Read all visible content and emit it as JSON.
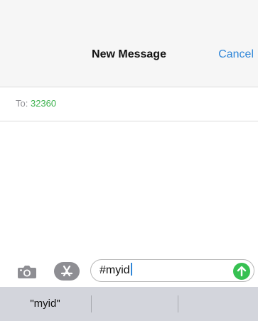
{
  "navbar": {
    "title": "New Message",
    "cancel_label": "Cancel"
  },
  "recipient": {
    "label": "To:",
    "value": "32360"
  },
  "compose": {
    "camera_icon": "camera-icon",
    "appstore_icon": "app-store-icon",
    "message_text": "#myid",
    "send_icon": "send-arrow-up-icon"
  },
  "suggestions": [
    {
      "label": "\"myid\""
    },
    {
      "label": ""
    },
    {
      "label": ""
    }
  ],
  "colors": {
    "accent_blue": "#2f86d8",
    "recipient_green": "#3eb24f",
    "send_green": "#37c152",
    "navbar_bg": "#f6f6f6",
    "suggestion_bar_bg": "#d3d5dc"
  }
}
